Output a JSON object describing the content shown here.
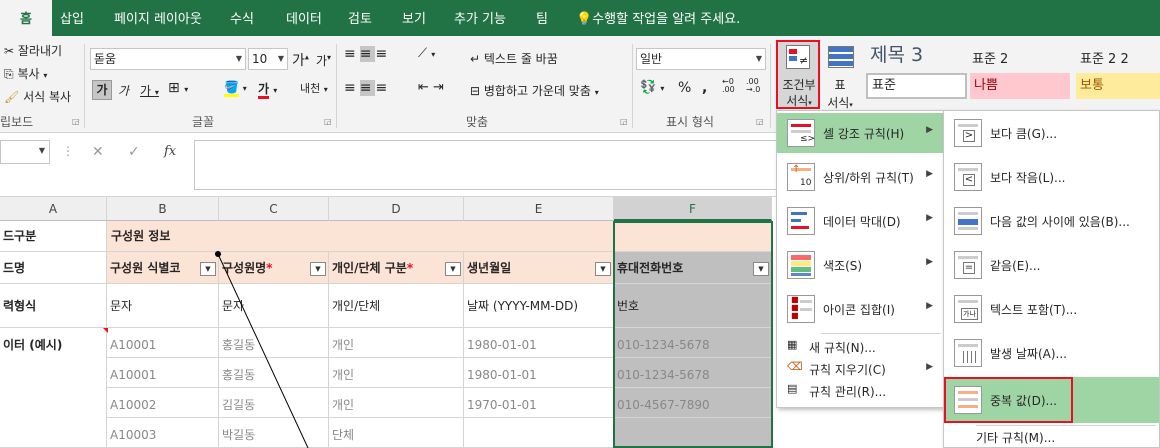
{
  "tabs": [
    "홈",
    "삽입",
    "페이지 레이아웃",
    "수식",
    "데이터",
    "검토",
    "보기",
    "추가 기능",
    "팀"
  ],
  "tell_me": "수행할 작업을 알려 주세요.",
  "clipboard": {
    "cut": "잘라내기",
    "copy": "복사",
    "format_painter": "서식 복사",
    "group": "립보드"
  },
  "font": {
    "name": "돋움",
    "size": "10",
    "bold": "가",
    "italic": "가",
    "underline": "가",
    "inc": "가",
    "dec": "가",
    "color": "가",
    "phonetic": "내천",
    "group": "글꼴"
  },
  "alignment": {
    "wrap": "텍스트 줄 바꿈",
    "merge": "병합하고 가운데 맞춤",
    "group": "맞춤"
  },
  "number": {
    "format": "일반",
    "percent": "%",
    "comma": ",",
    "group": "표시 형식"
  },
  "styles": {
    "cond_line1": "조건부",
    "cond_line2": "서식",
    "table_line1": "표",
    "table_line2": "서식",
    "heading": "제목 3",
    "normal2": "표준 2",
    "normal22": "표준 2 2",
    "normal": "표준",
    "bad": "나쁨",
    "neutral": "보통"
  },
  "formula_bar": {
    "cancel": "✕",
    "enter": "✓",
    "fx": "fx"
  },
  "columns": [
    "A",
    "B",
    "C",
    "D",
    "E",
    "F"
  ],
  "grid": {
    "a1": "드구분",
    "a2": "드명",
    "a3": "력형식",
    "a4": "이터 (예시)",
    "b1": "구성원 정보",
    "headers": [
      "구성원 식별코",
      "구성원명",
      "개인/단체 구분",
      "생년월일",
      "휴대전화번호"
    ],
    "star": "*",
    "types": [
      "문자",
      "문자",
      "개인/단체",
      "날짜 (YYYY-MM-DD)",
      "번호"
    ],
    "rows": [
      [
        "A10001",
        "홍길동",
        "개인",
        "1980-01-01",
        "010-1234-5678"
      ],
      [
        "A10001",
        "홍길동",
        "개인",
        "1980-01-01",
        "010-1234-5678"
      ],
      [
        "A10002",
        "김길동",
        "개인",
        "1970-01-01",
        "010-4567-7890"
      ],
      [
        "A10003",
        "박길동",
        "단체",
        "",
        ""
      ]
    ]
  },
  "cf_menu": {
    "items": [
      {
        "label": "셀 강조 규칙(H)"
      },
      {
        "label": "상위/하위 규칙(T)"
      },
      {
        "label": "데이터 막대(D)"
      },
      {
        "label": "색조(S)"
      },
      {
        "label": "아이콘 집합(I)"
      }
    ],
    "small": [
      {
        "label": "새 규칙(N)..."
      },
      {
        "label": "규칙 지우기(C)"
      },
      {
        "label": "규칙 관리(R)..."
      }
    ]
  },
  "sub_menu": {
    "items": [
      {
        "label": "보다 큼(G)..."
      },
      {
        "label": "보다 작음(L)..."
      },
      {
        "label": "다음 값의 사이에 있음(B)..."
      },
      {
        "label": "같음(E)..."
      },
      {
        "label": "텍스트 포함(T)..."
      },
      {
        "label": "발생 날짜(A)..."
      },
      {
        "label": "중복 값(D)..."
      }
    ],
    "more": "기타 규칙(M)..."
  },
  "colors": {
    "brand": "#217346",
    "highlight": "#cde6c7",
    "menu_highlight": "#9fd5a5",
    "red": "#e81123",
    "header_fill": "#fbe4d5",
    "gray_fill": "#bfbfbf",
    "bad_fill": "#ffc7ce",
    "neutral_fill": "#ffeb9c"
  }
}
